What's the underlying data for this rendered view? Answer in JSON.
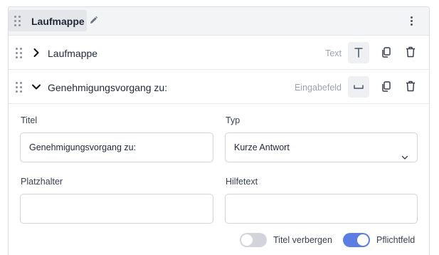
{
  "header": {
    "title": "Laufmappe"
  },
  "rows": [
    {
      "label": "Laufmappe",
      "type_label": "Text",
      "type_icon": "text-type-icon",
      "expanded": false
    },
    {
      "label": "Genehmigungsvorgang zu:",
      "type_label": "Eingabefeld",
      "type_icon": "input-field-icon",
      "expanded": true
    }
  ],
  "form": {
    "title_label": "Titel",
    "title_value": "Genehmigungsvorgang zu:",
    "type_label": "Typ",
    "type_value": "Kurze Antwort",
    "placeholder_label": "Platzhalter",
    "placeholder_value": "",
    "helptext_label": "Hilfetext",
    "helptext_value": ""
  },
  "toggles": {
    "hide_title_label": "Titel verbergen",
    "hide_title_on": false,
    "required_label": "Pflichtfeld",
    "required_on": true
  },
  "colors": {
    "accent": "#5b7ee5",
    "toggle_off": "#d1d5db"
  }
}
